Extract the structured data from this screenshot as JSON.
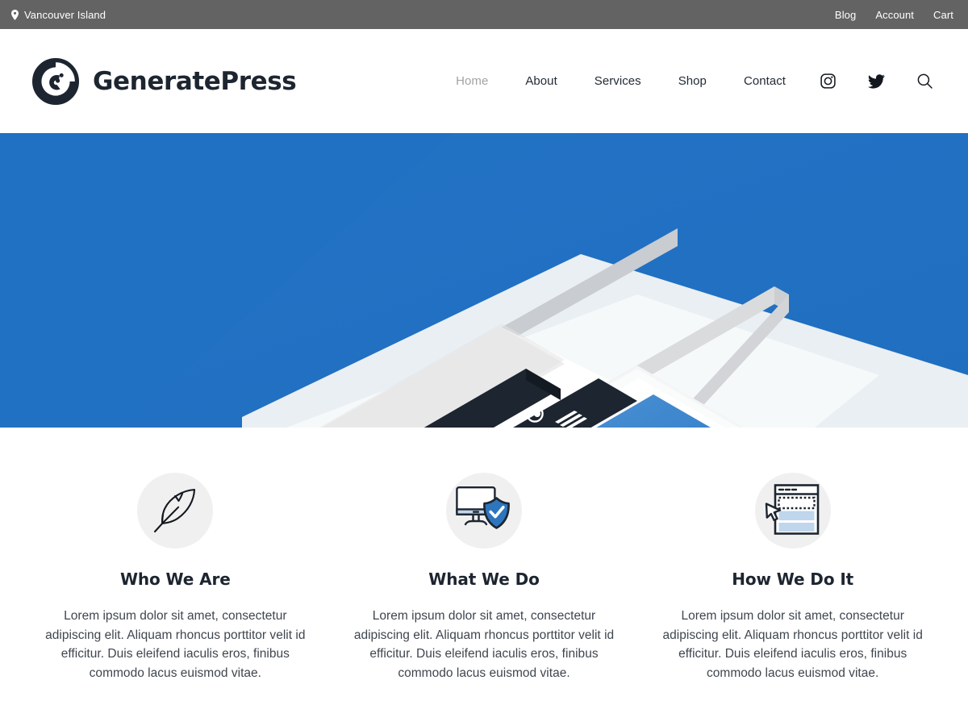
{
  "topbar": {
    "location_icon": "map-pin-icon",
    "location": "Vancouver Island",
    "links": [
      {
        "label": "Blog"
      },
      {
        "label": "Account"
      },
      {
        "label": "Cart"
      }
    ],
    "background_color": "#636363",
    "text_color": "#ffffff"
  },
  "header": {
    "logo_icon": "generatepress-logo-icon",
    "brand_name": "GeneratePress",
    "nav": [
      {
        "label": "Home",
        "current": true
      },
      {
        "label": "About",
        "current": false
      },
      {
        "label": "Services",
        "current": false
      },
      {
        "label": "Shop",
        "current": false
      },
      {
        "label": "Contact",
        "current": false
      }
    ],
    "icons": [
      {
        "name": "instagram-icon"
      },
      {
        "name": "twitter-icon"
      },
      {
        "name": "search-icon"
      }
    ],
    "current_link_color": "#a3a3a3",
    "link_color": "#222b36"
  },
  "hero": {
    "background_color": "#2070c3",
    "illustration": "isometric-browser-and-phone-mockup",
    "accent_dark": "#1d2530",
    "window_dots": [
      "#e06b5a",
      "#e8c14a",
      "#79c17e"
    ]
  },
  "features": [
    {
      "icon": "feather-quill-icon",
      "title": "Who We Are",
      "text": "Lorem ipsum dolor sit amet, consectetur adipiscing elit. Aliquam rhoncus porttitor velit id efficitur. Duis eleifend iaculis eros, finibus commodo lacus euismod vitae."
    },
    {
      "icon": "monitor-shield-check-icon",
      "title": "What We Do",
      "text": "Lorem ipsum dolor sit amet, consectetur adipiscing elit. Aliquam rhoncus porttitor velit id efficitur. Duis eleifend iaculis eros, finibus commodo lacus euismod vitae."
    },
    {
      "icon": "browser-cursor-select-icon",
      "title": "How We Do It",
      "text": "Lorem ipsum dolor sit amet, consectetur adipiscing elit. Aliquam rhoncus porttitor velit id efficitur. Duis eleifend iaculis eros, finibus commodo lacus euismod vitae."
    }
  ]
}
